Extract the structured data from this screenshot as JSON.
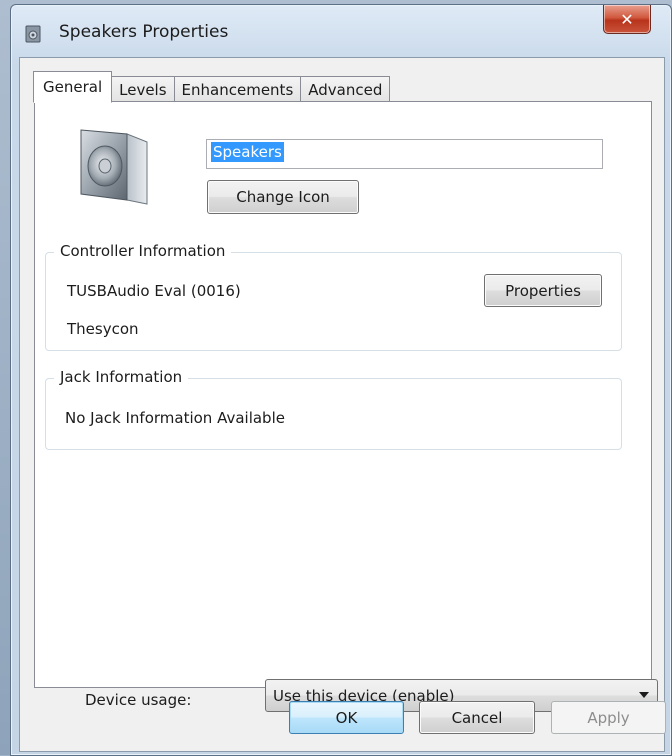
{
  "window": {
    "title": "Speakers Properties",
    "close_glyph": "✕"
  },
  "tabs": [
    {
      "label": "General",
      "active": true
    },
    {
      "label": "Levels",
      "active": false
    },
    {
      "label": "Enhancements",
      "active": false
    },
    {
      "label": "Advanced",
      "active": false
    }
  ],
  "general": {
    "device_name": "Speakers",
    "change_icon_label": "Change Icon",
    "controller": {
      "group_label": "Controller Information",
      "name": "TUSBAudio Eval (0016)",
      "manufacturer": "Thesycon",
      "properties_label": "Properties"
    },
    "jack": {
      "group_label": "Jack Information",
      "text": "No Jack Information Available"
    },
    "device_usage": {
      "label": "Device usage:",
      "selected": "Use this device (enable)"
    }
  },
  "footer": {
    "ok_label": "OK",
    "cancel_label": "Cancel",
    "apply_label": "Apply"
  },
  "colors": {
    "selection": "#3399ff",
    "close_red": "#c9543a"
  }
}
